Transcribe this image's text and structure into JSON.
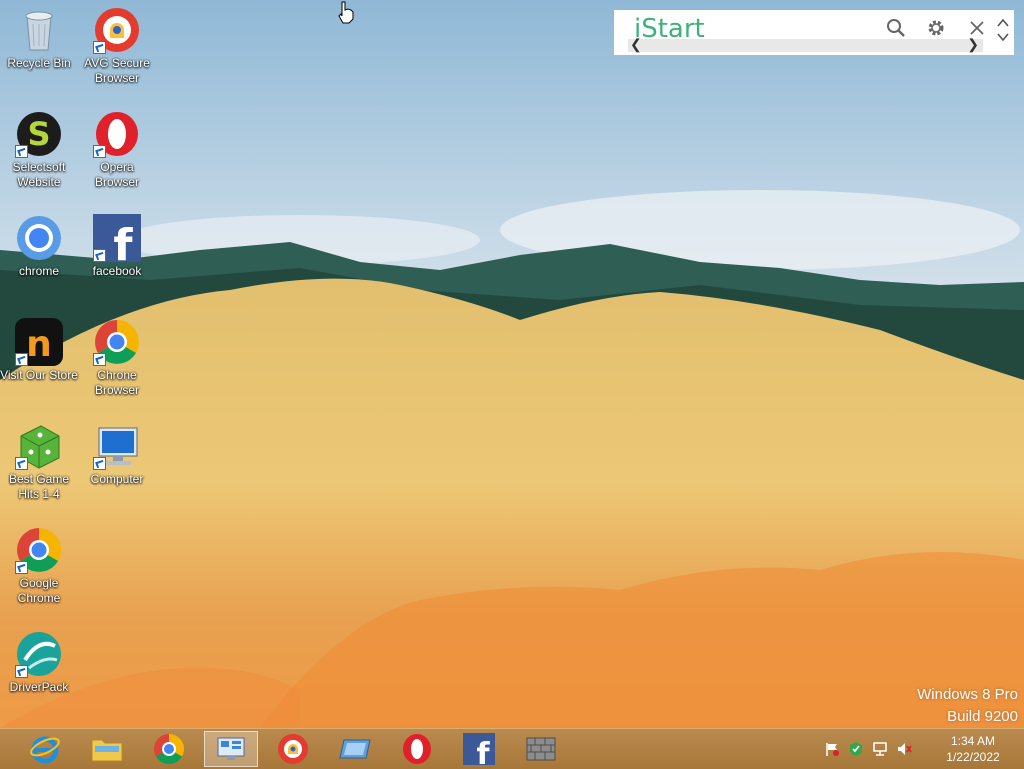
{
  "desktop": {
    "icons": [
      {
        "label": "Recycle Bin"
      },
      {
        "label": "AVG Secure Browser"
      },
      {
        "label": "Selectsoft Website"
      },
      {
        "label": "Opera Browser"
      },
      {
        "label": "chrome"
      },
      {
        "label": "facebook"
      },
      {
        "label": "Visit Our Store"
      },
      {
        "label": "Chrone Browser"
      },
      {
        "label": "Best Game Hits 1-4"
      },
      {
        "label": "Computer"
      },
      {
        "label": "Google Chrome"
      },
      {
        "label": "DriverPack"
      }
    ]
  },
  "istart": {
    "logo": "iStart",
    "icons": [
      "search-icon",
      "gear-icon",
      "close-icon",
      "chevron-up-icon",
      "chevron-down-icon"
    ]
  },
  "watermark": {
    "line1": "Windows 8 Pro",
    "line2": "Build 9200"
  },
  "taskbar": {
    "apps": [
      "internet-explorer",
      "file-explorer",
      "chrome",
      "control-panel",
      "avg-secure-browser",
      "remote-desktop",
      "opera",
      "facebook",
      "firewall"
    ],
    "tray_icons": [
      "flag-icon",
      "security-check-icon",
      "network-icon",
      "volume-muted-icon"
    ],
    "clock": {
      "time": "1:34 AM",
      "date": "1/22/2022"
    }
  },
  "colors": {
    "istart_green": "#3fb17a",
    "taskbar": "#b07f43"
  }
}
